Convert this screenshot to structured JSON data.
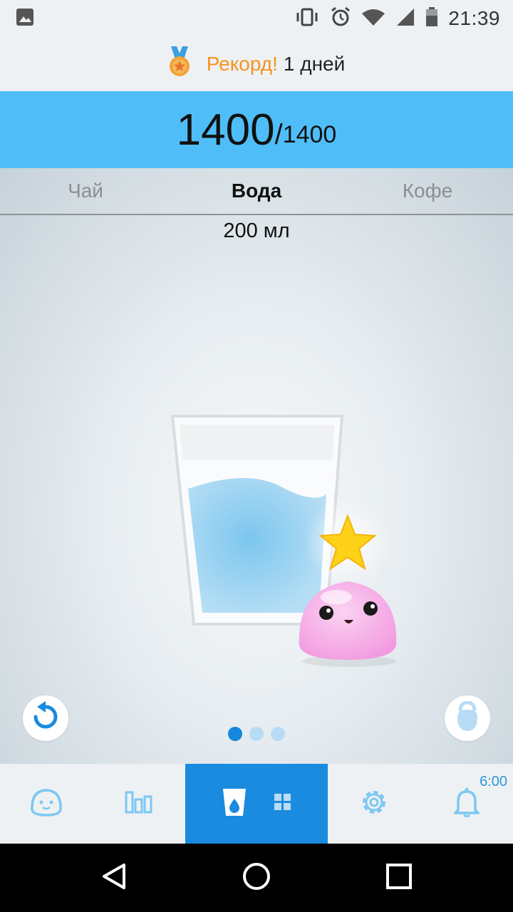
{
  "status_bar": {
    "time": "21:39",
    "icons": [
      "image-icon",
      "vibrate-icon",
      "alarm-icon",
      "wifi-icon",
      "signal-icon",
      "battery-icon"
    ]
  },
  "record": {
    "label": "Рекорд!",
    "value": "1 дней",
    "icon": "medal-icon"
  },
  "goal": {
    "current": "1400",
    "separator": "/",
    "total": "1400"
  },
  "drink_tabs": [
    {
      "label": "Чай",
      "active": false
    },
    {
      "label": "Вода",
      "active": true
    },
    {
      "label": "Кофе",
      "active": false
    }
  ],
  "volume": "200 мл",
  "pager": {
    "count": 3,
    "active_index": 0
  },
  "bottom_nav": {
    "items": [
      "mascot-icon",
      "stats-icon",
      "drink-icon",
      "settings-icon",
      "bell-icon"
    ],
    "active": "drink-icon",
    "reminder_time": "6:00"
  },
  "colors": {
    "banner": "#4fbef8",
    "record_label": "#f5931e",
    "nav_active": "#1a8bde",
    "icon_light_blue": "#7cc8f2"
  }
}
